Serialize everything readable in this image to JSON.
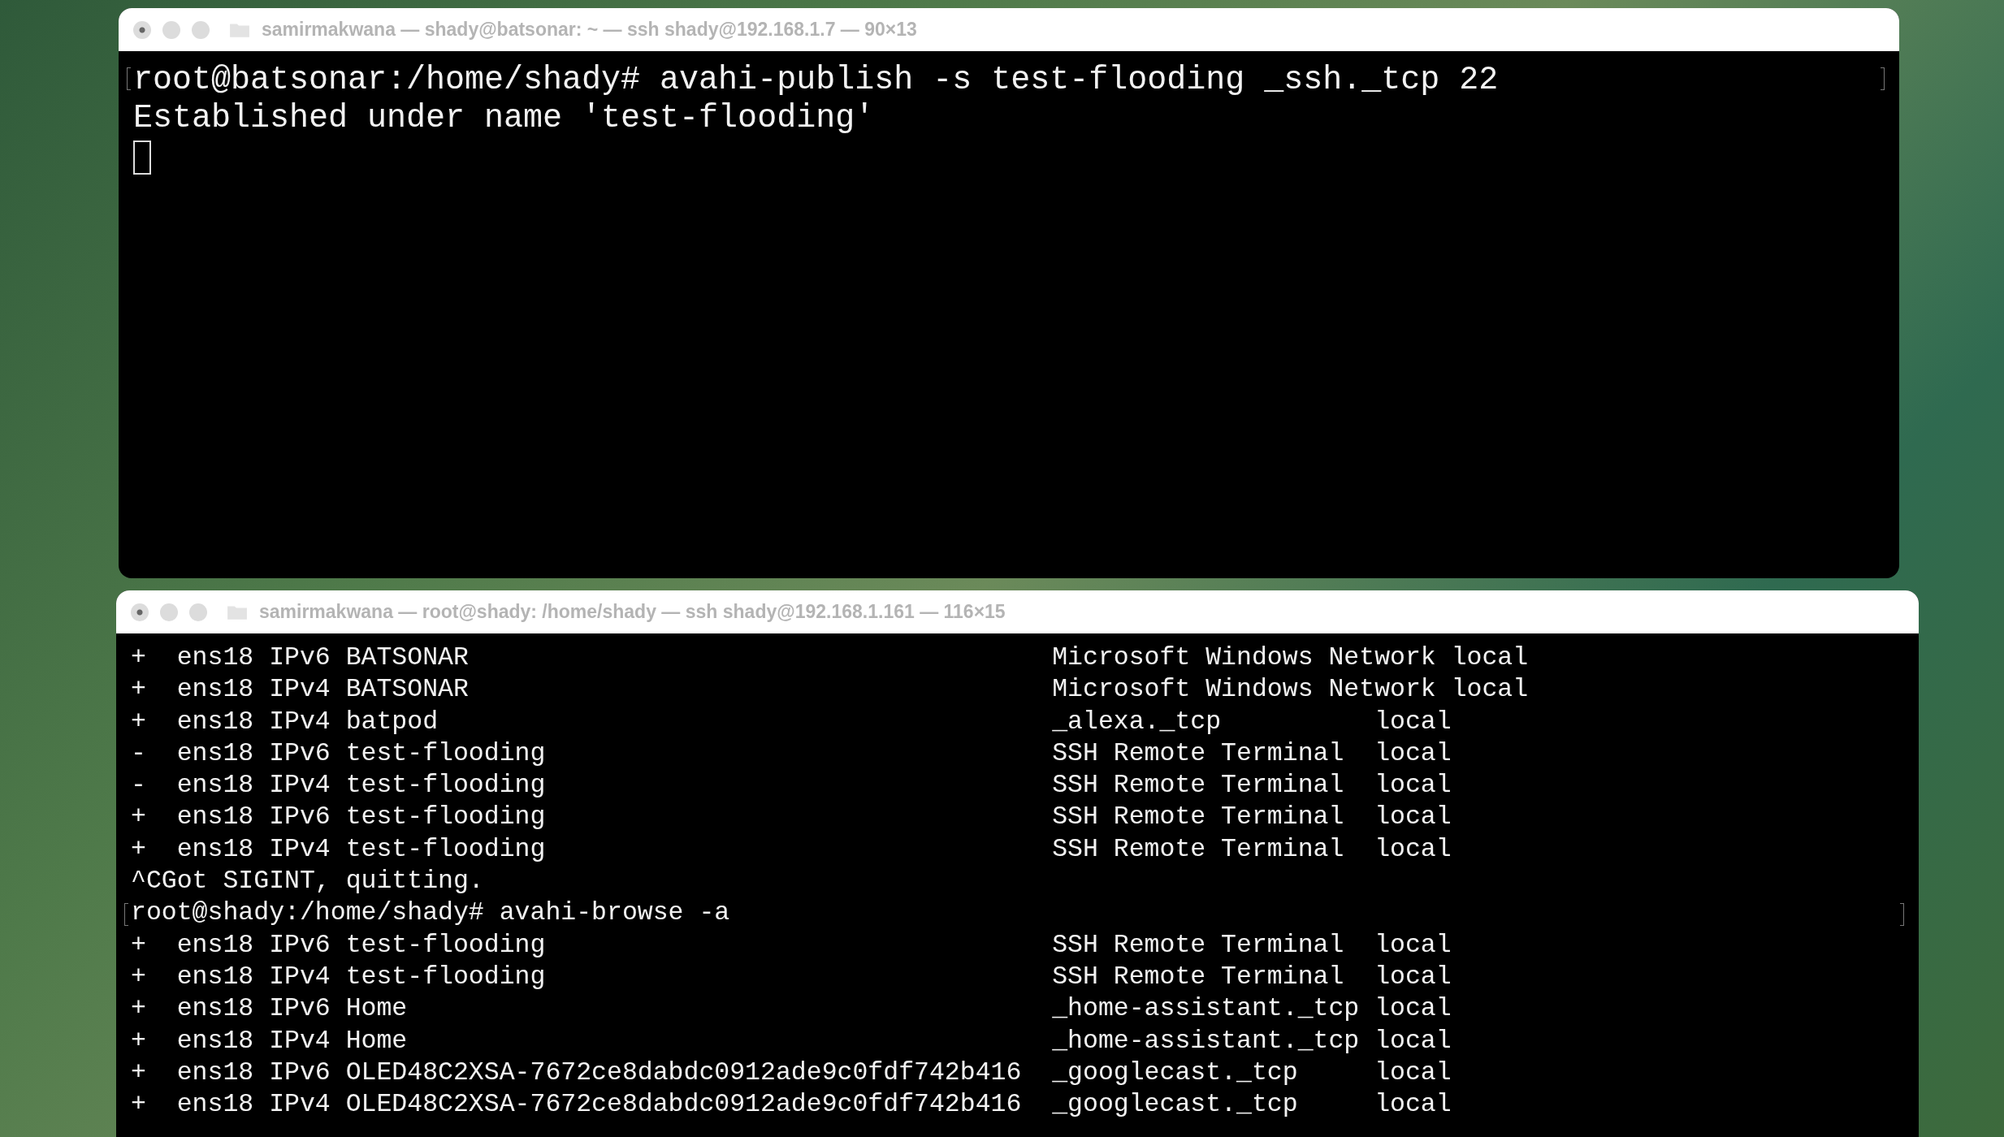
{
  "windows": [
    {
      "title": "samirmakwana — shady@batsonar: ~ — ssh shady@192.168.1.7 — 90×13",
      "kind": "large",
      "cursor": true,
      "lines": [
        {
          "text": "root@batsonar:/home/shady# avahi-publish -s test-flooding _ssh._tcp 22",
          "marked": true
        },
        {
          "text": "Established under name 'test-flooding'",
          "marked": false
        }
      ]
    },
    {
      "title": "samirmakwana — root@shady: /home/shady — ssh shady@192.168.1.161 — 116×15",
      "kind": "small",
      "cursor": false,
      "lines": [
        {
          "text": "+  ens18 IPv6 BATSONAR                                      Microsoft Windows Network local",
          "marked": false
        },
        {
          "text": "+  ens18 IPv4 BATSONAR                                      Microsoft Windows Network local",
          "marked": false
        },
        {
          "text": "+  ens18 IPv4 batpod                                        _alexa._tcp          local",
          "marked": false
        },
        {
          "text": "-  ens18 IPv6 test-flooding                                 SSH Remote Terminal  local",
          "marked": false
        },
        {
          "text": "-  ens18 IPv4 test-flooding                                 SSH Remote Terminal  local",
          "marked": false
        },
        {
          "text": "+  ens18 IPv6 test-flooding                                 SSH Remote Terminal  local",
          "marked": false
        },
        {
          "text": "+  ens18 IPv4 test-flooding                                 SSH Remote Terminal  local",
          "marked": false
        },
        {
          "text": "^CGot SIGINT, quitting.",
          "marked": false
        },
        {
          "text": "root@shady:/home/shady# avahi-browse -a",
          "marked": true
        },
        {
          "text": "+  ens18 IPv6 test-flooding                                 SSH Remote Terminal  local",
          "marked": false
        },
        {
          "text": "+  ens18 IPv4 test-flooding                                 SSH Remote Terminal  local",
          "marked": false
        },
        {
          "text": "+  ens18 IPv6 Home                                          _home-assistant._tcp local",
          "marked": false
        },
        {
          "text": "+  ens18 IPv4 Home                                          _home-assistant._tcp local",
          "marked": false
        },
        {
          "text": "+  ens18 IPv6 OLED48C2XSA-7672ce8dabdc0912ade9c0fdf742b416  _googlecast._tcp     local",
          "marked": false
        },
        {
          "text": "+  ens18 IPv4 OLED48C2XSA-7672ce8dabdc0912ade9c0fdf742b416  _googlecast._tcp     local",
          "marked": false
        }
      ]
    }
  ]
}
